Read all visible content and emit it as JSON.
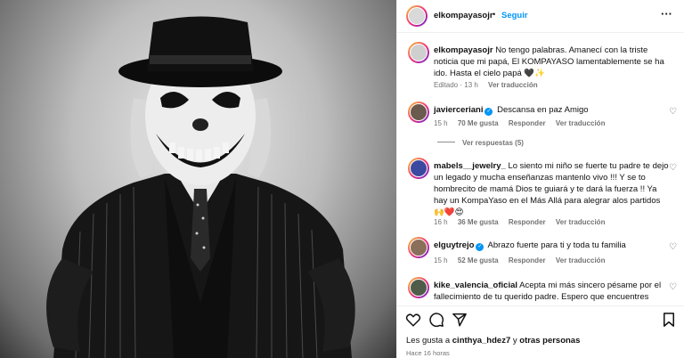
{
  "post": {
    "photo_alt_icon": "clown-photo",
    "username": "elkompayasojr",
    "dot": "•",
    "follow_label": "Seguir",
    "more_icon": "more-icon",
    "caption": {
      "username": "elkompayasojr",
      "text": "No tengo palabras. Amanecí con la triste noticia que mi papá, El KOMPAYASO lamentablemente se ha ido. Hasta el cielo papá 🖤✨",
      "edited": "Editado · 13 h",
      "translate": "Ver traducción"
    },
    "comments": [
      {
        "username": "javierceriani",
        "verified": true,
        "text": "Descansa en paz Amigo",
        "time": "15 h",
        "likes": "70 Me gusta",
        "reply": "Responder",
        "translate": "Ver traducción",
        "replies_label": "Ver respuestas (5)"
      },
      {
        "username": "mabels__jewelry_",
        "verified": false,
        "text": "Lo siento mi niño se fuerte tu padre te dejo un legado y mucha enseñanzas mantenlo vivo !!! Y se to hombrecito de mamá Dios te guiará y te dará la fuerza !! Ya hay un KompaYaso en el Más Allá para alegrar alos partidos 🙌❤️😍",
        "time": "16 h",
        "likes": "36 Me gusta",
        "reply": "Responder",
        "translate": "Ver traducción"
      },
      {
        "username": "elguytrejo",
        "verified": true,
        "text": "Abrazo fuerte para ti y toda tu familia",
        "time": "15 h",
        "likes": "52 Me gusta",
        "reply": "Responder",
        "translate": "Ver traducción"
      },
      {
        "username": "kike_valencia_oficial",
        "verified": false,
        "text": "Acepta mi más sincero pésame por el fallecimiento de tu querido padre. Espero que encuentres"
      }
    ],
    "likes_prefix": "Les gusta a",
    "likes_user": "cinthya_hdez7",
    "likes_mid": "y",
    "likes_others": "otras personas",
    "posted_ago": "Hace 16 horas",
    "colors": {
      "link": "#0095f6",
      "muted": "#737373",
      "text": "#111111"
    }
  }
}
